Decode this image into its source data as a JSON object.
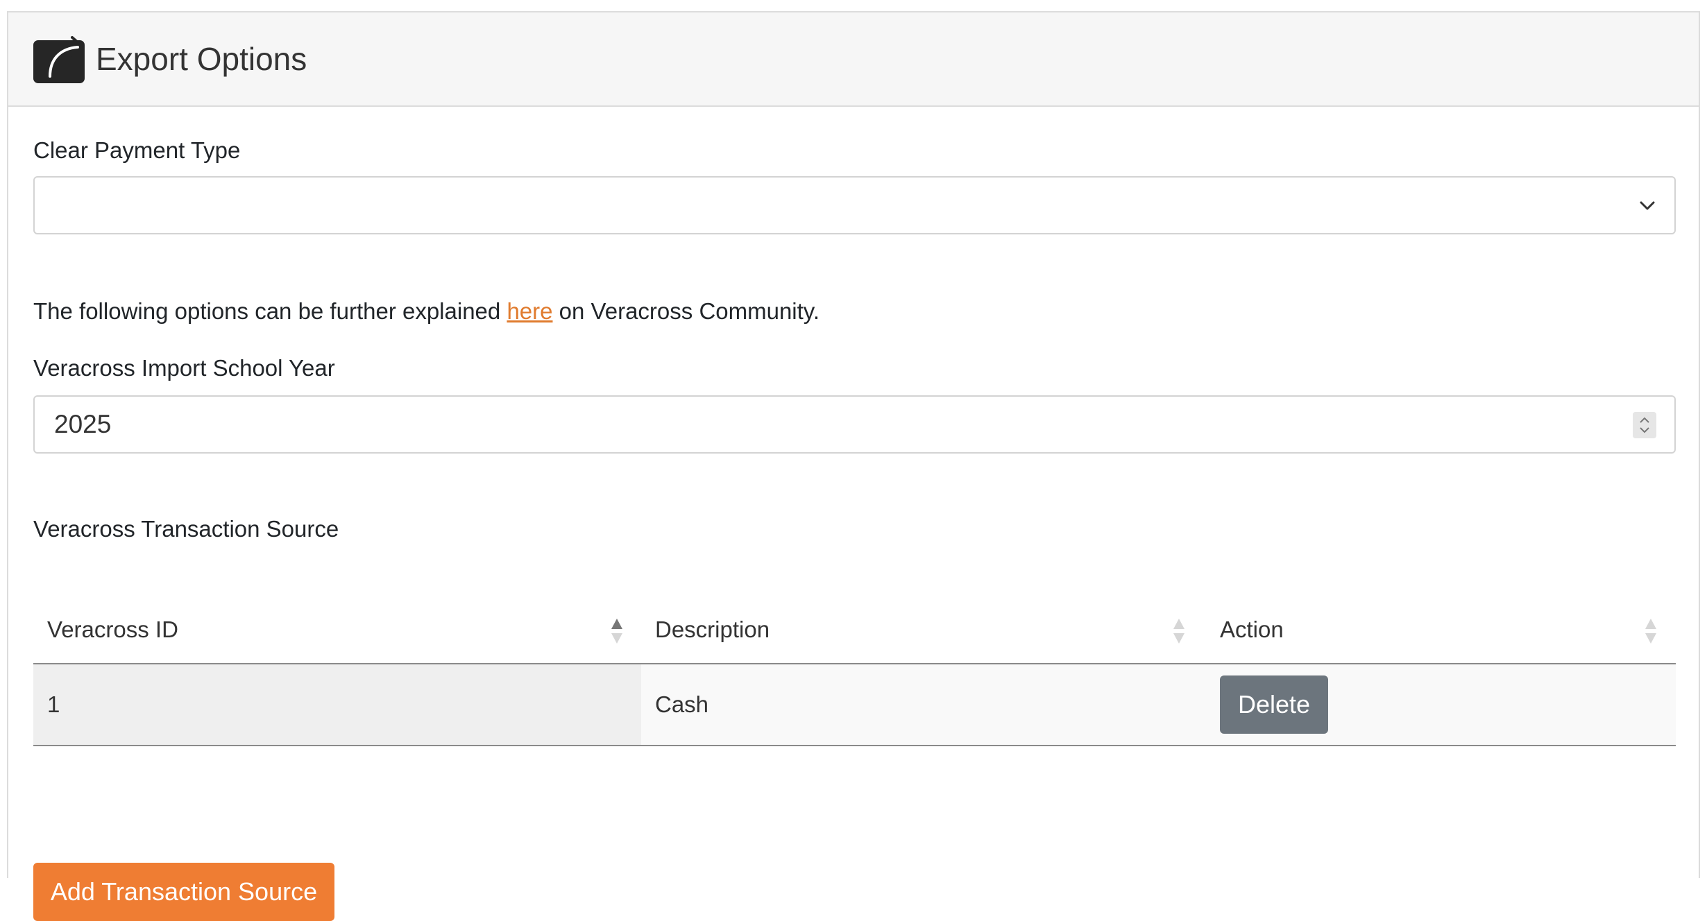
{
  "panel": {
    "title": "Export Options",
    "icon": "share-arrow-icon"
  },
  "payment_type": {
    "label": "Clear Payment Type",
    "selected_value": ""
  },
  "info": {
    "text_before": "The following options can be further explained ",
    "link_text": "here",
    "text_after": " on Veracross Community."
  },
  "school_year": {
    "label": "Veracross Import School Year",
    "value": "2025"
  },
  "transaction_source": {
    "label": "Veracross Transaction Source",
    "columns": [
      "Veracross ID",
      "Description",
      "Action"
    ],
    "rows": [
      {
        "id": "1",
        "description": "Cash",
        "action_label": "Delete"
      }
    ],
    "add_button_label": "Add Transaction Source"
  },
  "colors": {
    "accent": "#ef7d33",
    "link": "#e07b2e",
    "delete_button": "#6c757d"
  }
}
